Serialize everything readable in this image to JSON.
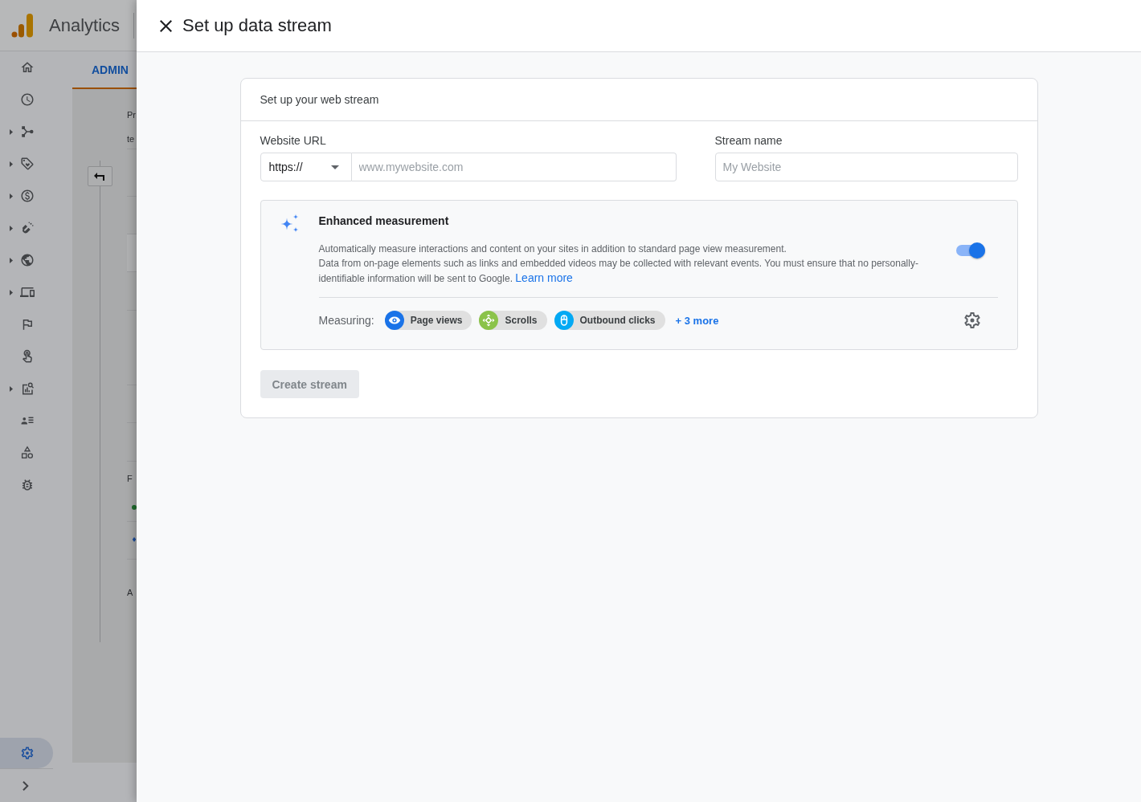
{
  "app_bar": {
    "product": "Analytics"
  },
  "sidebar": {
    "items": [
      {
        "expandable": false,
        "selected": false
      },
      {
        "expandable": false,
        "selected": false
      },
      {
        "expandable": true,
        "selected": false
      },
      {
        "expandable": true,
        "selected": false
      },
      {
        "expandable": true,
        "selected": false
      },
      {
        "expandable": true,
        "selected": false
      },
      {
        "expandable": true,
        "selected": false
      },
      {
        "expandable": true,
        "selected": false
      },
      {
        "expandable": false,
        "selected": false
      },
      {
        "expandable": false,
        "selected": false
      },
      {
        "expandable": true,
        "selected": false
      },
      {
        "expandable": false,
        "selected": false
      },
      {
        "expandable": false,
        "selected": false
      },
      {
        "expandable": false,
        "selected": false
      }
    ],
    "admin_item": {
      "selected": true
    }
  },
  "admin": {
    "tab": {
      "label": "ADMIN",
      "selected": true
    },
    "column_texts": [
      "Pr",
      "te",
      "F",
      "A"
    ]
  },
  "dialog": {
    "title": "Set up data stream",
    "card": {
      "title": "Set up your web stream",
      "url_field": {
        "label": "Website URL",
        "protocol": "https://",
        "placeholder": "www.mywebsite.com"
      },
      "name_field": {
        "label": "Stream name",
        "placeholder": "My Website"
      },
      "enhanced_measurement": {
        "title": "Enhanced measurement",
        "description": "Automatically measure interactions and content on your sites in addition to standard page view measurement.",
        "notice": "Data from on-page elements such as links and embedded videos may be collected with relevant events. You must ensure that no personally-identifiable information will be sent to Google.",
        "link": "Learn more",
        "enabled": true,
        "measuring_label": "Measuring:",
        "events": [
          {
            "label": "Page views",
            "kind": "pageview",
            "color": "#1a73e8"
          },
          {
            "label": "Scrolls",
            "kind": "scroll",
            "color": "#8bc34a"
          },
          {
            "label": "Outbound clicks",
            "kind": "click",
            "color": "#03a9f4"
          }
        ],
        "more_link": "+ 3 more"
      },
      "create_button": {
        "label": "Create stream",
        "disabled": true
      }
    }
  }
}
